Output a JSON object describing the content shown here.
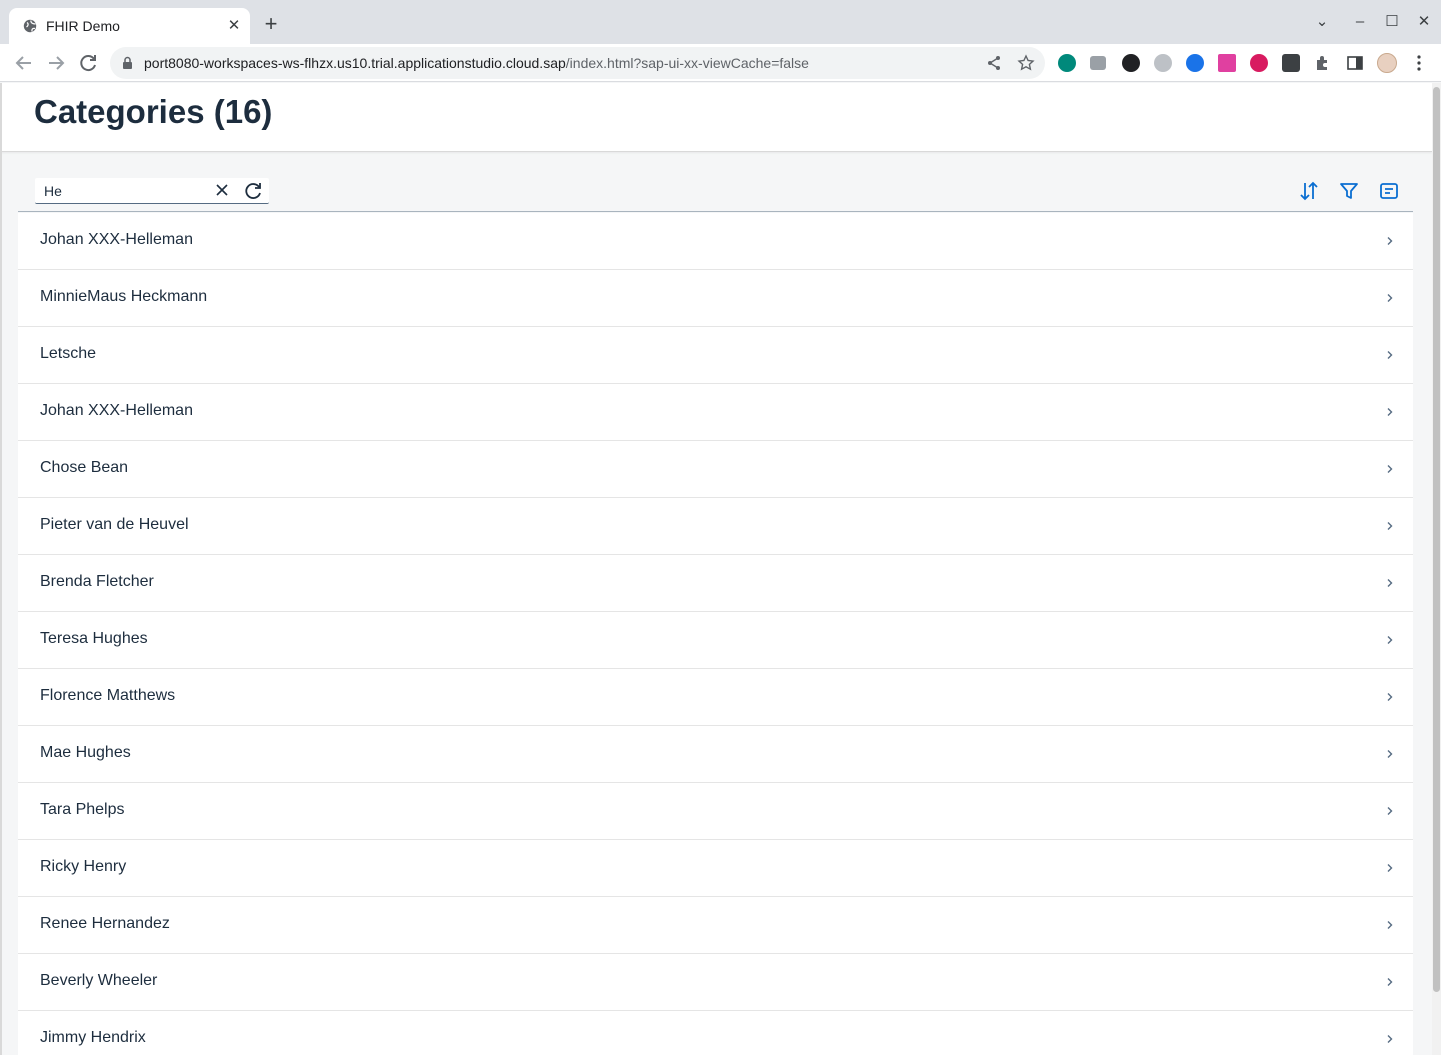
{
  "browser": {
    "tab_title": "FHIR Demo",
    "url_host": "port8080-workspaces-ws-flhzx.us10.trial.applicationstudio.cloud.sap",
    "url_path": "/index.html?sap-ui-xx-viewCache=false",
    "icons": {
      "back": "back-arrow-icon",
      "forward": "forward-arrow-icon",
      "reload": "reload-icon",
      "share": "share-icon",
      "bookmark": "star-icon",
      "extensions": "puzzle-icon",
      "menu": "kebab-menu-icon"
    }
  },
  "page": {
    "title": "Categories (16)"
  },
  "search": {
    "value": "He",
    "placeholder": ""
  },
  "toolbar": {
    "sort_icon": "sort-icon",
    "filter_icon": "filter-icon",
    "group_icon": "group-icon",
    "accent_color": "#0a6ed1"
  },
  "list": {
    "items": [
      {
        "label": "Johan XXX-Helleman"
      },
      {
        "label": "MinnieMaus Heckmann"
      },
      {
        "label": "Letsche"
      },
      {
        "label": "Johan XXX-Helleman"
      },
      {
        "label": "Chose Bean"
      },
      {
        "label": "Pieter van de Heuvel"
      },
      {
        "label": "Brenda Fletcher"
      },
      {
        "label": "Teresa Hughes"
      },
      {
        "label": "Florence Matthews"
      },
      {
        "label": "Mae Hughes"
      },
      {
        "label": "Tara Phelps"
      },
      {
        "label": "Ricky Henry"
      },
      {
        "label": "Renee Hernandez"
      },
      {
        "label": "Beverly Wheeler"
      },
      {
        "label": "Jimmy Hendrix"
      }
    ]
  }
}
